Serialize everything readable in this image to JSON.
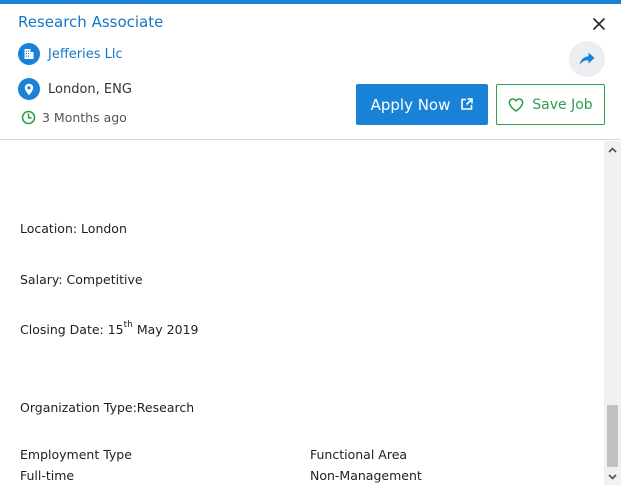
{
  "header": {
    "job_title": "Research Associate",
    "company": "Jefferies Llc",
    "location": "London, ENG",
    "posted": "3 Months ago",
    "apply_label": "Apply Now",
    "save_label": "Save Job"
  },
  "icons": {
    "close": "close-icon",
    "company": "building-icon",
    "location": "map-pin-icon",
    "time": "clock-icon",
    "share": "share-icon",
    "external": "external-link-icon",
    "heart": "heart-icon"
  },
  "colors": {
    "accent": "#1a82d6",
    "link": "#1477c6",
    "save_green": "#2e9e4f"
  },
  "details": {
    "location_line": "Location: London",
    "salary_line": "Salary: Competitive",
    "closing_prefix": "Closing Date: 15",
    "closing_sup": "th",
    "closing_suffix": " May 2019",
    "org_type_line": "Organization Type:Research",
    "employment_type_label": "Employment Type",
    "employment_type_value": "Full-time",
    "functional_area_label": "Functional Area",
    "functional_area_value": "Non-Management"
  }
}
